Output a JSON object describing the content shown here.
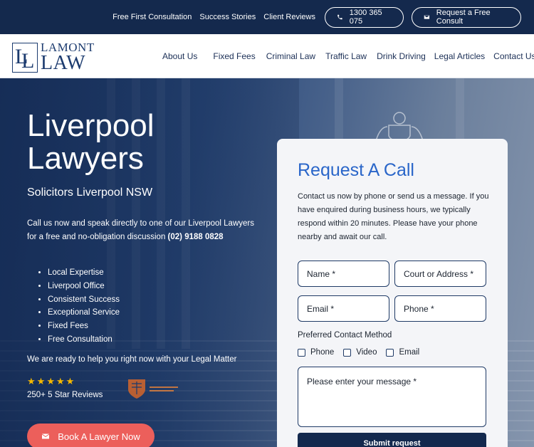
{
  "topbar": {
    "links": [
      "Free First Consultation",
      "Success Stories",
      "Client Reviews"
    ],
    "phone_label": "1300 365 075",
    "consult_label": "Request a Free Consult"
  },
  "logo": {
    "line1": "LAMONT",
    "line2": "LAW",
    "mark": "LL"
  },
  "nav": {
    "items": [
      "About Us",
      "Fixed Fees",
      "Criminal Law",
      "Traffic Law",
      "Drink Driving",
      "Legal Articles",
      "Contact Us"
    ]
  },
  "hero": {
    "title_line1": "Liverpool",
    "title_line2": "Lawyers",
    "subtitle": "Solicitors Liverpool NSW",
    "intro": "Call us now and speak directly to one of our Liverpool Lawyers for a free and no-obligation discussion",
    "intro_phone": "(02) 9188 0828",
    "features": [
      "Local Expertise",
      "Liverpool Office",
      "Consistent Success",
      "Exceptional Service",
      "Fixed Fees",
      "Free Consultation"
    ],
    "ready_text": "We are ready to help you right now with your Legal Matter",
    "rating_stars": 5,
    "reviews_text": "250+ 5 Star Reviews",
    "book_label": "Book A Lawyer Now",
    "star_color": "#f5b800",
    "accent_color": "#ec5f5b"
  },
  "form": {
    "title": "Request A Call",
    "description": "Contact us now by phone or send us a message. If you have enquired during business hours, we typically respond within 20 minutes. Please have your phone nearby and await our call.",
    "name_placeholder": "Name *",
    "court_placeholder": "Court or Address *",
    "email_placeholder": "Email *",
    "phone_placeholder": "Phone *",
    "pref_label": "Preferred Contact Method",
    "options": [
      "Phone",
      "Video",
      "Email"
    ],
    "message_placeholder": "Please enter your message *",
    "submit_label": "Submit request",
    "title_color": "#2a66c9",
    "button_color": "#13294e"
  }
}
